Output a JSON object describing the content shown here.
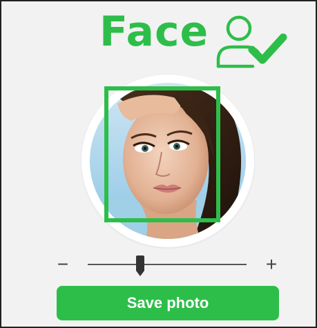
{
  "header": {
    "title": "Face",
    "icon": "user-check-icon"
  },
  "photo": {
    "alt": "Portrait photo with face detection box",
    "face_detected": true
  },
  "zoom": {
    "minus_label": "−",
    "plus_label": "+",
    "level": 0.33
  },
  "actions": {
    "save_label": "Save photo"
  },
  "colors": {
    "accent": "#2dbe4a",
    "background": "#f2f2f2",
    "text": "#444444"
  }
}
